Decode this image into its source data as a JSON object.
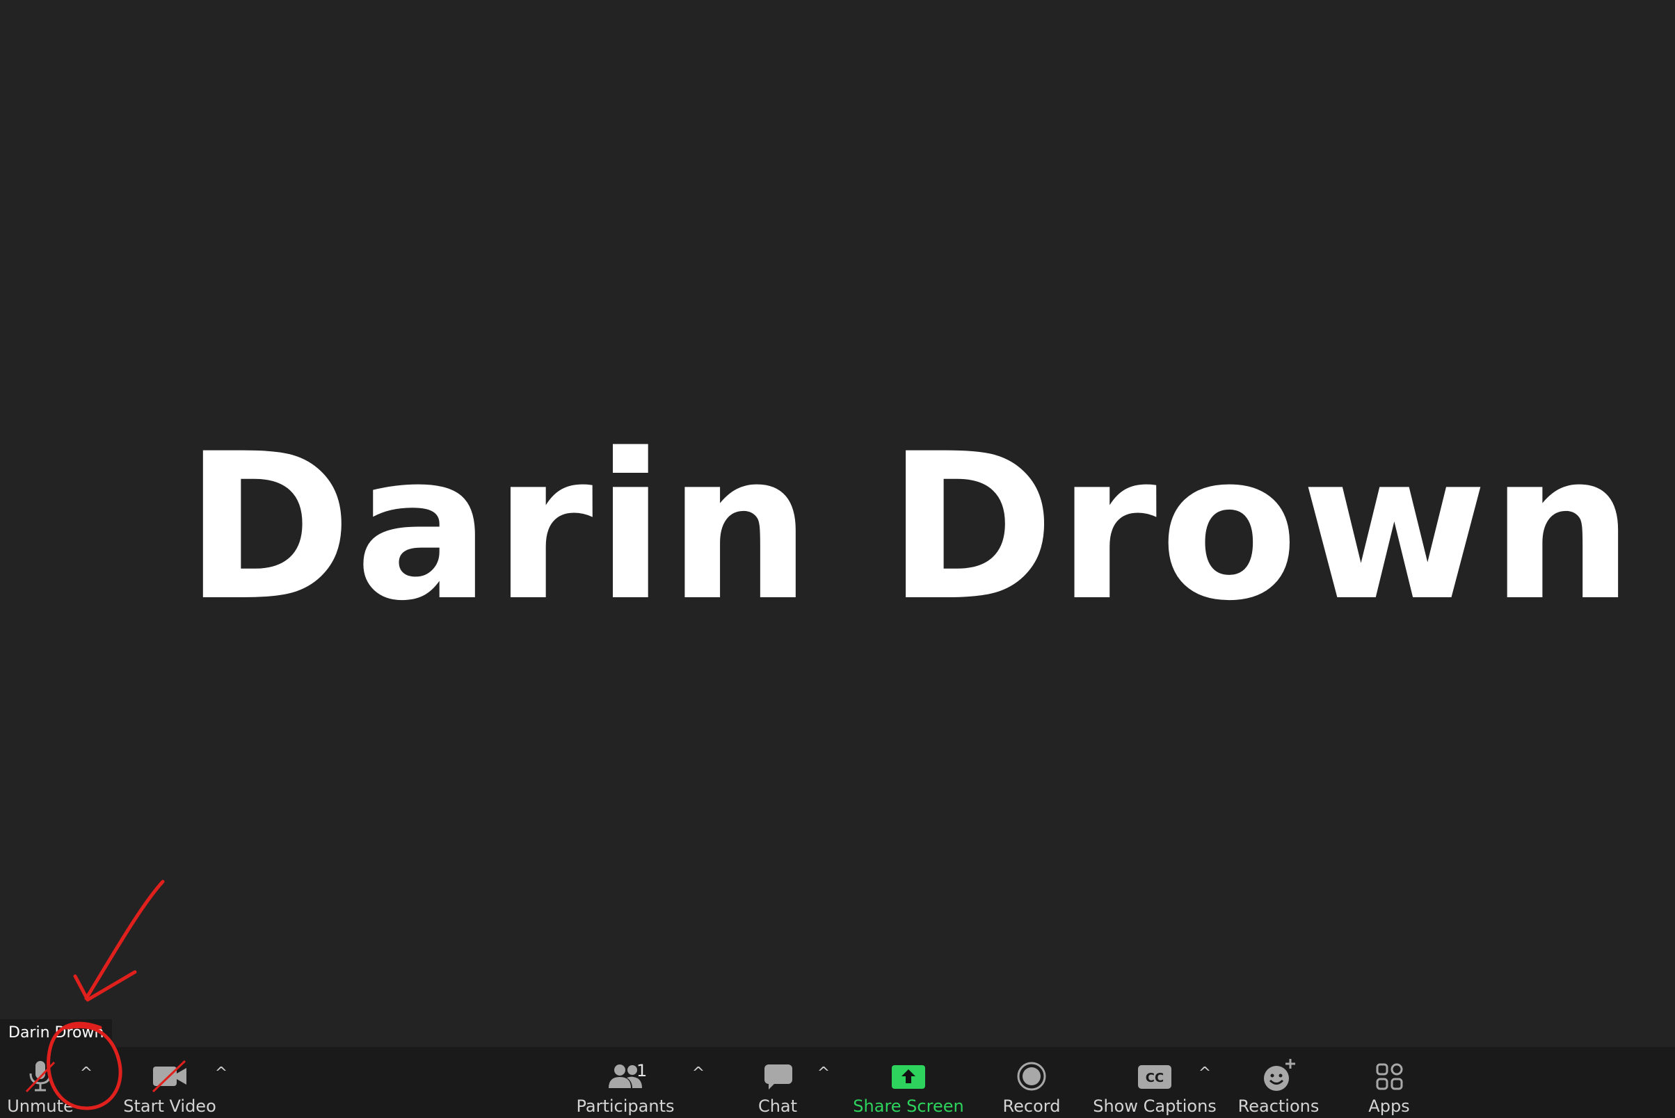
{
  "screen": {
    "participant_name_large": "Darin Drown",
    "name_tag": "Darin Drown"
  },
  "toolbar": {
    "unmute_label": "Unmute",
    "start_video_label": "Start Video",
    "participants_label": "Participants",
    "participants_count": "1",
    "chat_label": "Chat",
    "share_screen_label": "Share Screen",
    "record_label": "Record",
    "show_captions_label": "Show Captions",
    "captions_icon_text": "CC",
    "reactions_label": "Reactions",
    "apps_label": "Apps",
    "caret_glyph": "^"
  },
  "colors": {
    "background": "#232323",
    "toolbar": "#1a1a1a",
    "share_green": "#2dd35c",
    "annotation_red": "#e0201c"
  }
}
